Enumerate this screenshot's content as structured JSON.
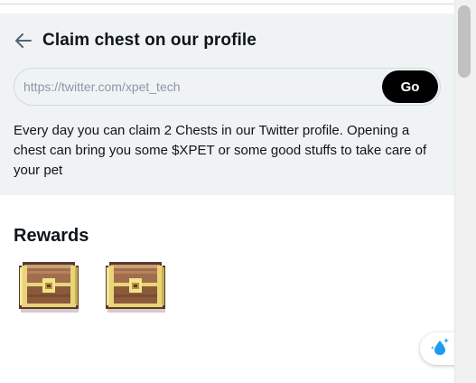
{
  "header": {
    "back_icon": "arrow-left-icon",
    "title": "Claim chest on our profile"
  },
  "url_form": {
    "placeholder": "https://twitter.com/xpet_tech",
    "value": "",
    "go_label": "Go"
  },
  "description": "Every day you can claim 2 Chests in our Twitter profile. Opening a chest can bring you some $XPET or some good stuffs to take care of your pet",
  "rewards": {
    "heading": "Rewards",
    "items": [
      {
        "icon": "treasure-chest-icon"
      },
      {
        "icon": "treasure-chest-icon"
      }
    ]
  },
  "floating_button": {
    "icon": "water-drop-sparkle-icon"
  },
  "colors": {
    "panel_background": "#eff3f4",
    "go_button": "#000000",
    "text": "#0f1419",
    "placeholder": "#8b98a5",
    "accent_blue": "#1d9bf0",
    "chest_wood": "#8a5a3b",
    "chest_gold": "#e9d47a"
  }
}
